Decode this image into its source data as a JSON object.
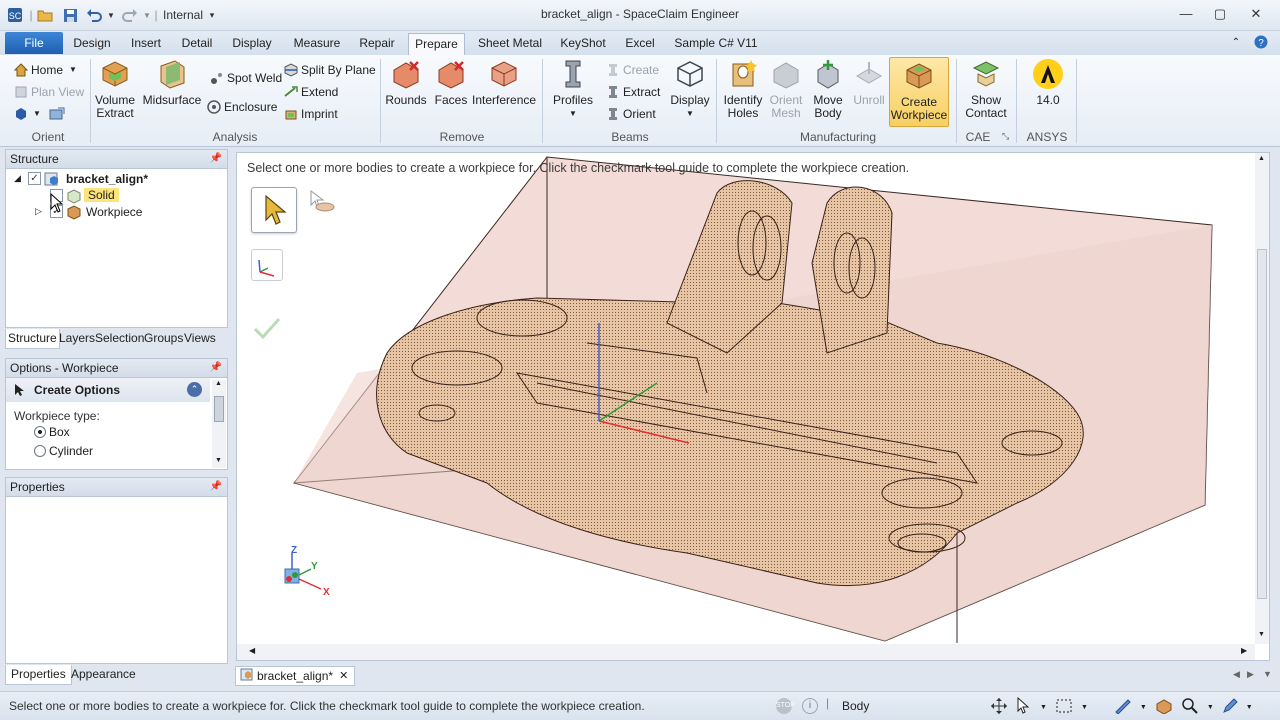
{
  "window": {
    "title": "bracket_align - SpaceClaim Engineer",
    "qat_dropdown": "Internal"
  },
  "menu": {
    "file": "File",
    "tabs": [
      "Design",
      "Insert",
      "Detail",
      "Display",
      "Measure",
      "Repair",
      "Prepare",
      "Sheet Metal",
      "KeyShot",
      "Excel",
      "Sample C# V11"
    ],
    "active_tab": "Prepare"
  },
  "ribbon": {
    "orient": {
      "label": "Orient",
      "home": "Home",
      "plan_view": "Plan View"
    },
    "analysis": {
      "label": "Analysis",
      "volume_extract": "Volume Extract",
      "midsurface": "Midsurface",
      "spot_weld": "Spot Weld",
      "enclosure": "Enclosure",
      "split_by_plane": "Split By Plane",
      "extend": "Extend",
      "imprint": "Imprint"
    },
    "remove": {
      "label": "Remove",
      "rounds": "Rounds",
      "faces": "Faces",
      "interference": "Interference"
    },
    "beams": {
      "label": "Beams",
      "profiles": "Profiles",
      "create": "Create",
      "extract": "Extract",
      "orient": "Orient",
      "display": "Display"
    },
    "manufacturing": {
      "label": "Manufacturing",
      "identify_holes": "Identify Holes",
      "orient_mesh": "Orient Mesh",
      "move_body": "Move Body",
      "unroll": "Unroll",
      "create_workpiece": "Create Workpiece"
    },
    "cae": {
      "label": "CAE",
      "show_contact": "Show Contact"
    },
    "ansys": {
      "label": "ANSYS",
      "version": "14.0"
    }
  },
  "structure": {
    "title": "Structure",
    "root": "bracket_align*",
    "items": [
      "Solid",
      "Workpiece"
    ],
    "tabs": [
      "Structure",
      "Layers",
      "Selection",
      "Groups",
      "Views"
    ]
  },
  "options": {
    "title": "Options - Workpiece",
    "section": "Create Options",
    "type_label": "Workpiece type:",
    "types": [
      "Box",
      "Cylinder"
    ],
    "selected_type": "Box"
  },
  "properties": {
    "title": "Properties",
    "tabs": [
      "Properties",
      "Appearance"
    ]
  },
  "viewport": {
    "prompt": "Select one or more bodies to create a workpiece for. Click the checkmark tool guide to complete the workpiece creation.",
    "triad": {
      "z": "Z",
      "y": "Y",
      "x": "X"
    }
  },
  "document_tab": "bracket_align*",
  "status": {
    "message": "Select one or more bodies to create a workpiece for. Click the checkmark tool guide to complete the workpiece creation.",
    "selection_mode": "Body"
  }
}
